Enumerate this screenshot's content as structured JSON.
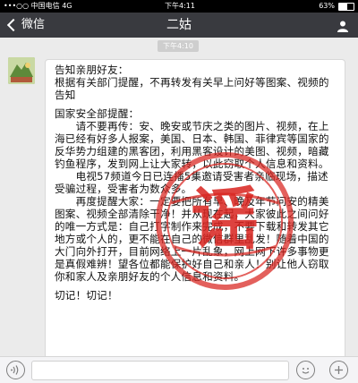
{
  "status": {
    "signal": "•••○○ 中国电信 4G",
    "time": "下午4:11",
    "battery": "63%"
  },
  "nav": {
    "back_label": "微信",
    "title": "二姑"
  },
  "chat": {
    "timestamp": "下午4:10",
    "message_lines": [
      "告知亲朋好友：",
      "根据有关部门提醒，不再转发有关早上问好等图案、视频的告知",
      "",
      "国家安全部提醒：",
      "　　请不要再传：安、晚安或节庆之类的图片、视频，在上海已经有好多人报案，美国、日本、韩国、菲律宾等国家的反华势力组建的黑客团，利用黑客设计的美图、视频，暗藏钓鱼程序，发到网上让大家转，以此窃取个人信息和资料。",
      "　　电视57频道今日已连播5集邀请受害者亲临现场，描述受骗过程，受害者为数众多。",
      "　　再度提醒大家：一定要把所有早、晚及年节问安的精美图案、视频全部清除干净！并从现在起，大家彼此之间问好的唯一方式是：自己打字制作来完成，不要下载和转发其它地方或个人的，更不能在自己的微信群里乱发！随着中国的大门向外打开，目前网络上一片乱象，网上网下许多事物更是真假难辨！望各位都能保护好自己和亲人！别让他人窃取你和家人及亲朋好友的个人信息和资料。",
      "",
      "切记！切记！"
    ],
    "stamp_text": "谣"
  },
  "toolbar": {
    "voice_icon": "voice-icon",
    "emoji_icon": "emoji-icon",
    "plus_icon": "plus-icon"
  },
  "colors": {
    "nav_bg": "#393a3f",
    "chat_bg": "#ebebeb",
    "stamp_red": "#d9231e"
  }
}
